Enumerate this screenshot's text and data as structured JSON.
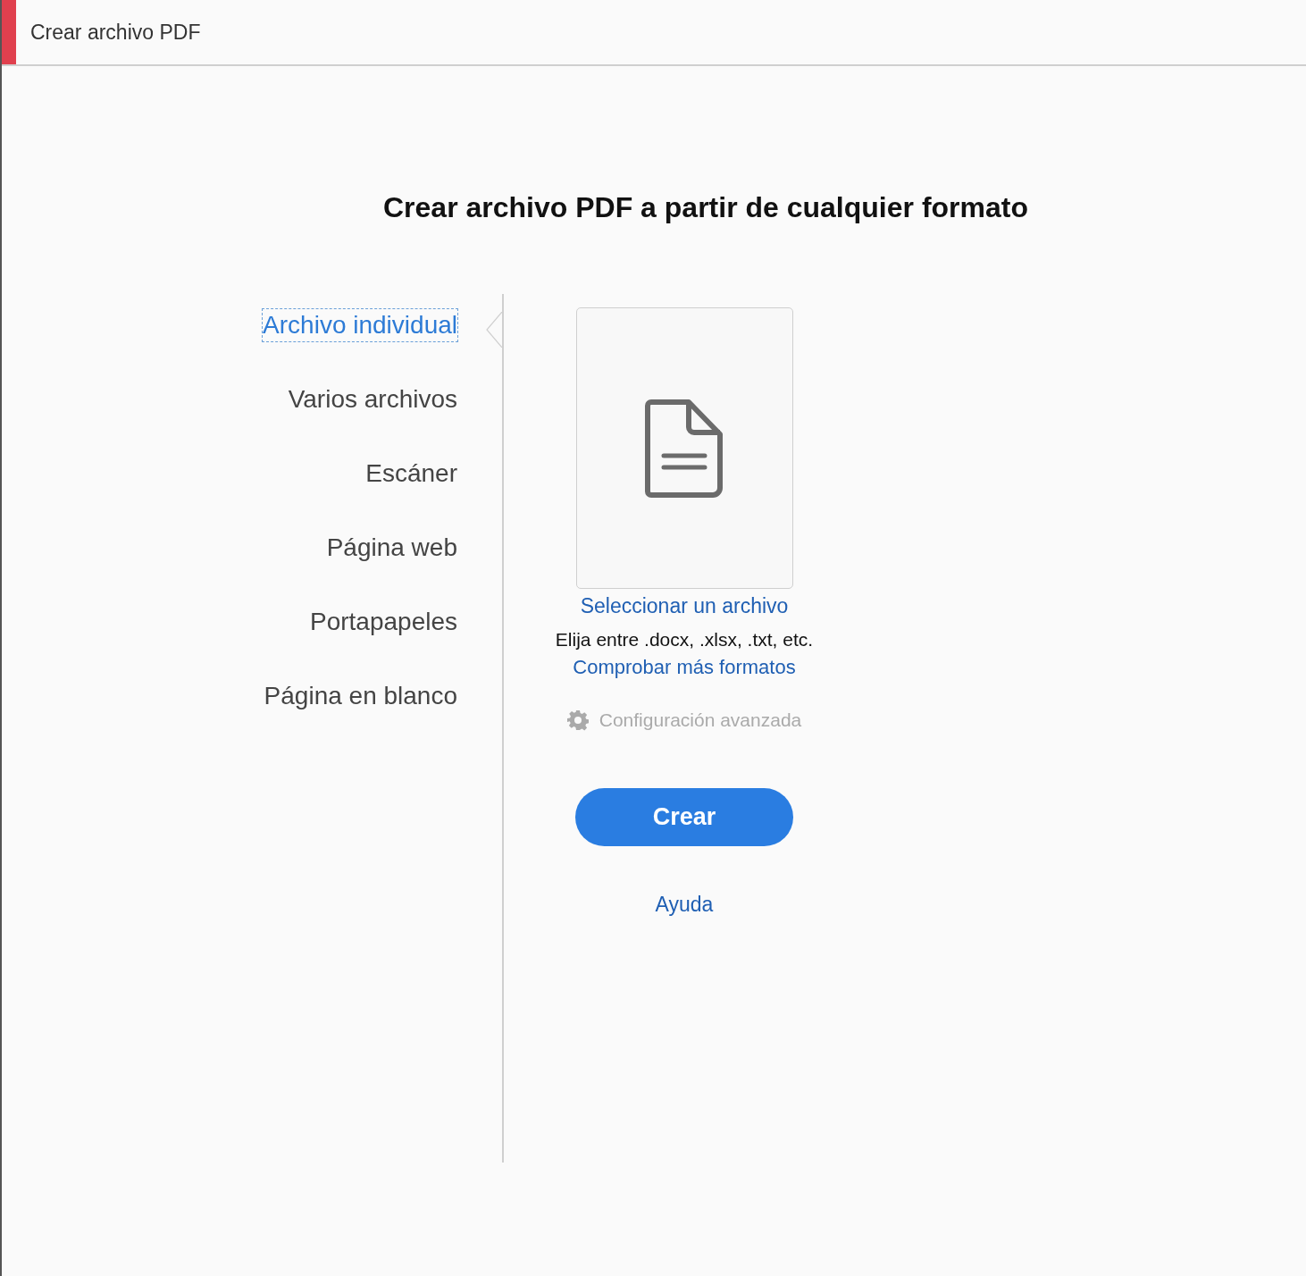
{
  "window": {
    "title": "Crear archivo PDF"
  },
  "heading": "Crear archivo PDF a partir de cualquier formato",
  "options": [
    {
      "label": "Archivo individual",
      "selected": true
    },
    {
      "label": "Varios archivos",
      "selected": false
    },
    {
      "label": "Escáner",
      "selected": false
    },
    {
      "label": "Página web",
      "selected": false
    },
    {
      "label": "Portapapeles",
      "selected": false
    },
    {
      "label": "Página en blanco",
      "selected": false
    }
  ],
  "file_picker": {
    "select_link": "Seleccionar un archivo",
    "hint": "Elija entre .docx, .xlsx, .txt, etc.",
    "formats_link": "Comprobar más formatos"
  },
  "advanced_settings": {
    "label": "Configuración avanzada",
    "disabled": true
  },
  "create_button": "Crear",
  "help_link": "Ayuda"
}
